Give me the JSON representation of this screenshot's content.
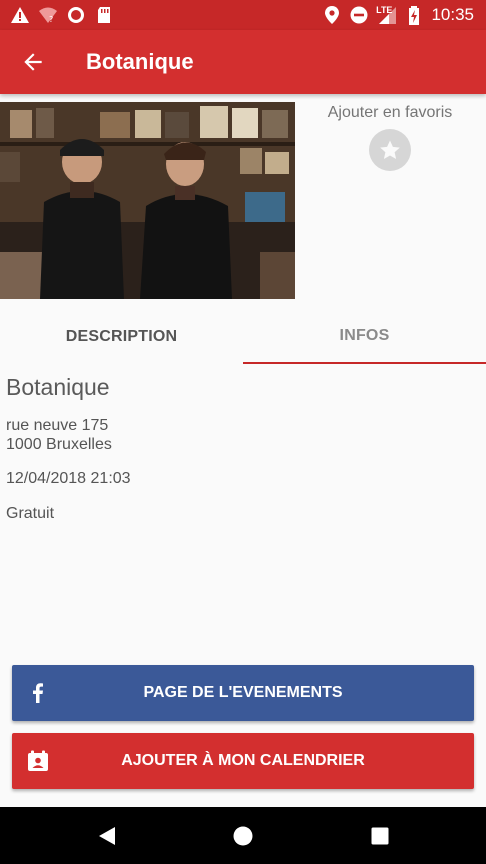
{
  "status_bar": {
    "time": "10:35",
    "network_label": "LTE",
    "icons": [
      "warning-icon",
      "wifi-question-icon",
      "record-icon",
      "sd-card-icon",
      "location-icon",
      "do-not-disturb-icon",
      "signal-icon",
      "battery-charging-icon"
    ]
  },
  "app_bar": {
    "title": "Botanique",
    "back_icon": "arrow-left-icon"
  },
  "favorites": {
    "label": "Ajouter en favoris",
    "icon": "star-icon"
  },
  "tabs": [
    {
      "label": "DESCRIPTION",
      "active": false
    },
    {
      "label": "INFOS",
      "active": true
    }
  ],
  "info": {
    "venue": "Botanique",
    "address_line1": "rue neuve 175",
    "address_line2": "1000 Bruxelles",
    "datetime": "12/04/2018 21:03",
    "price": "Gratuit"
  },
  "buttons": {
    "event_page": "PAGE DE L'EVENEMENTS",
    "add_calendar": "AJOUTER À MON CALENDRIER"
  },
  "colors": {
    "primary": "#d32f2f",
    "status_bar": "#c62828",
    "facebook": "#3b5998",
    "tab_indicator": "#c62828"
  }
}
